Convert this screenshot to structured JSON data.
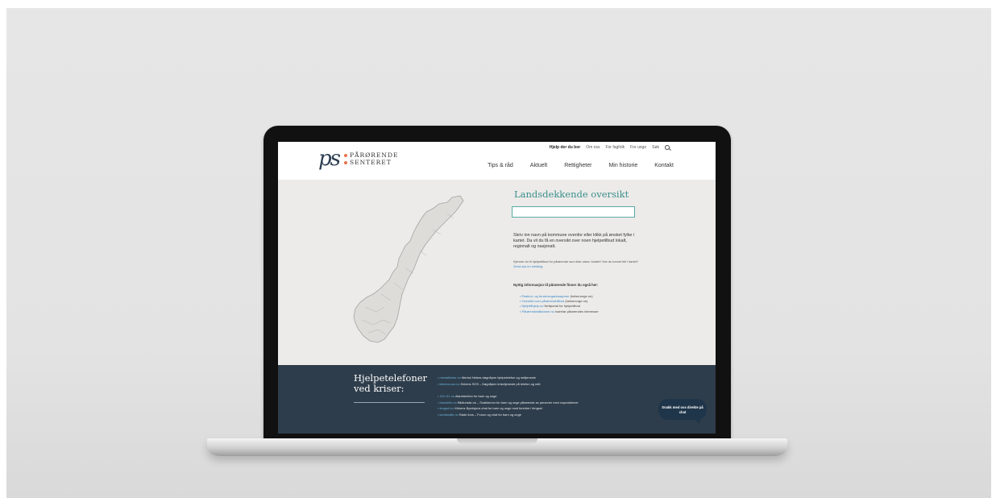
{
  "header": {
    "logo_mark": "ps",
    "logo_line1": "PÅRØRENDE",
    "logo_line2": "SENTERET",
    "top_links": [
      "Hjelp der du bor",
      "Om oss",
      "For fagfolk",
      "For unge",
      "Søk"
    ],
    "nav": [
      "Tips & råd",
      "Aktuelt",
      "Rettigheter",
      "Min historie",
      "Kontakt"
    ]
  },
  "main": {
    "title": "Landsdekkende oversikt",
    "search_value": "",
    "intro": "Skriv inn navn på kommune ovenfor eller klikk på ønsket fylke i kartet. Da vil du få en oversikt over noen hjelpetilbud lokalt, regionalt og nasjonalt.",
    "small_text": "Kjenner du til hjelpetilbud for pårørende som ikke vises i kartet? Har du funnet feil i kartet?",
    "small_link": "Send oss en melding.",
    "useful_title": "Nyttig informasjon til pårørende finner du også her:",
    "useful": [
      {
        "link": "Pasient- og brukerorganisasjoner",
        "text": "(helsenorge.no)"
      },
      {
        "link": "Oversikt over pårørendetilbud",
        "text": "(helsenorge.no)"
      },
      {
        "link": "Hjelpitilhjelp.no",
        "text": "Nettportal for hjelpetilbud"
      },
      {
        "link": "Pårørendealliansen.no",
        "text": "Ivaretar pårørendes interesser"
      }
    ]
  },
  "footer": {
    "heading1": "Hjelpetelefoner",
    "heading2": "ved kriser:",
    "lines": [
      {
        "link": "mentalhelse.no",
        "text": "Mental Helses døgnåpne hjelpetelefon og nettjeneste"
      },
      {
        "link": "kirkens-sos.no",
        "text": "Kirkens SOS – Døgnåpen krisetjeneste på telefon og nett"
      },
      {
        "link": "116 111.no",
        "text": "Alarmtelefon for barn og unge"
      },
      {
        "link": "barnsinfo.no",
        "text": "Bildlunskk.no – Snakkerom for barn og unge pårørende av personer med rusproblemer"
      },
      {
        "link": "fengsel.no",
        "text": "Kirkens Bymisjons chat for barn og unge med foreldre i fengsel"
      },
      {
        "link": "korsforalle.no",
        "text": "Røde kors – Forum og chat for barn og unge"
      }
    ],
    "chat": "Snakk med oss direkte på chat"
  }
}
